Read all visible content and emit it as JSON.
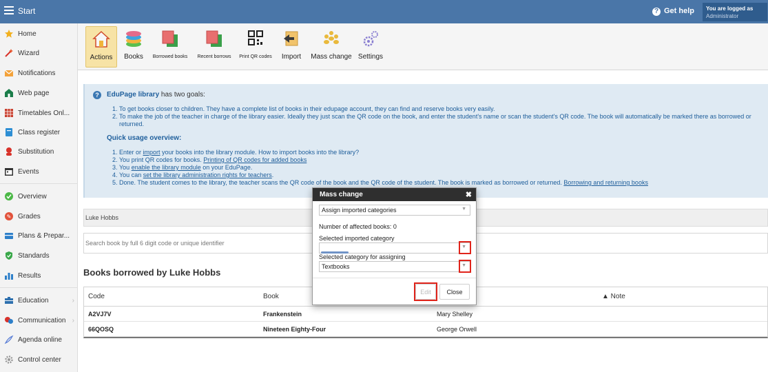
{
  "topbar": {
    "title": "Start",
    "help": "Get help",
    "logged_line1": "You are logged as",
    "logged_line2": "Administrator"
  },
  "sidebar": {
    "items": [
      {
        "label": "Home",
        "icon": "star-icon"
      },
      {
        "label": "Wizard",
        "icon": "wand-icon"
      },
      {
        "label": "Notifications",
        "icon": "envelope-icon"
      },
      {
        "label": "Web page",
        "icon": "house-icon"
      },
      {
        "label": "Timetables Onl...",
        "icon": "timetable-icon"
      },
      {
        "label": "Class register",
        "icon": "register-icon"
      },
      {
        "label": "Substitution",
        "icon": "person-icon"
      },
      {
        "label": "Events",
        "icon": "calendar-icon"
      },
      {
        "label": "Overview",
        "icon": "check-circle-icon"
      },
      {
        "label": "Grades",
        "icon": "grades-icon"
      },
      {
        "label": "Plans & Prepar...",
        "icon": "plans-icon"
      },
      {
        "label": "Standards",
        "icon": "shield-icon"
      },
      {
        "label": "Results",
        "icon": "bar-chart-icon"
      },
      {
        "label": "Education",
        "icon": "education-icon"
      },
      {
        "label": "Communication",
        "icon": "chat-icon"
      },
      {
        "label": "Agenda online",
        "icon": "pen-icon"
      },
      {
        "label": "Control center",
        "icon": "gear-icon"
      }
    ]
  },
  "toolbar": {
    "items": [
      {
        "label": "Actions",
        "icon": "home-icon"
      },
      {
        "label": "Books",
        "icon": "books-icon"
      },
      {
        "label": "Borrowed books",
        "icon": "borrowed-icon"
      },
      {
        "label": "Recent borrows",
        "icon": "recent-icon"
      },
      {
        "label": "Print QR codes",
        "icon": "qr-icon"
      },
      {
        "label": "Import",
        "icon": "import-icon"
      },
      {
        "label": "Mass change",
        "icon": "people-icon"
      },
      {
        "label": "Settings",
        "icon": "gear-icon"
      }
    ]
  },
  "info": {
    "brand": "EduPage library",
    "head_rest": " has two goals:",
    "goal1": "To get books closer to children. They have a complete list of books in their edupage account, they can find and reserve books very easily.",
    "goal2": "To make the job of the teacher in charge of the library easier. Ideally they just scan the QR code on the book, and enter the student's name or scan the student's QR code. The book will automatically be marked there as borrowed or returned.",
    "quick_title": "Quick usage overview:",
    "s1_pre": "Enter or ",
    "s1_link": "import",
    "s1_post": " your books into the library module. How to import books into the library?",
    "s2_pre": "You print QR codes for books. ",
    "s2_link": "Printing of QR codes for added books",
    "s3_pre": "You ",
    "s3_link": "enable the library module",
    "s3_post": " on your EduPage.",
    "s4_pre": "You can ",
    "s4_link": "set the library administration rights for teachers",
    "s4_post": ".",
    "s5_pre": "Done. The student comes to the library, the teacher scans the QR code of the book and the QR code of the student. The book is marked as borrowed or returned. ",
    "s5_link": "Borrowing and returning books"
  },
  "student_selector": "Luke Hobbs",
  "search_placeholder": "Search book by full 6 digit code or unique identifier",
  "section_title": "Books borrowed by Luke Hobbs",
  "table": {
    "headers": [
      "Code",
      "Book",
      "",
      "▲ Note"
    ],
    "rows": [
      {
        "code": "A2VJ7V",
        "book": "Frankenstein",
        "author": "Mary Shelley",
        "note": ""
      },
      {
        "code": "66QOSQ",
        "book": "Nineteen Eighty-Four",
        "author": "George Orwell",
        "note": ""
      }
    ]
  },
  "modal": {
    "title": "Mass change",
    "close_x": "✖",
    "action_select": "Assign imported categories",
    "affected": "Number of affected books: 0",
    "imported_label": "Selected imported category",
    "assign_label": "Selected category for assigning",
    "assign_value": "Textbooks",
    "edit_button": "Edit",
    "close_button": "Close"
  },
  "colors": {
    "topbar": "#4a76a8",
    "highlight": "#e0231a",
    "info_bg": "#dfeaf3",
    "active_tool": "#f7e3a6"
  }
}
